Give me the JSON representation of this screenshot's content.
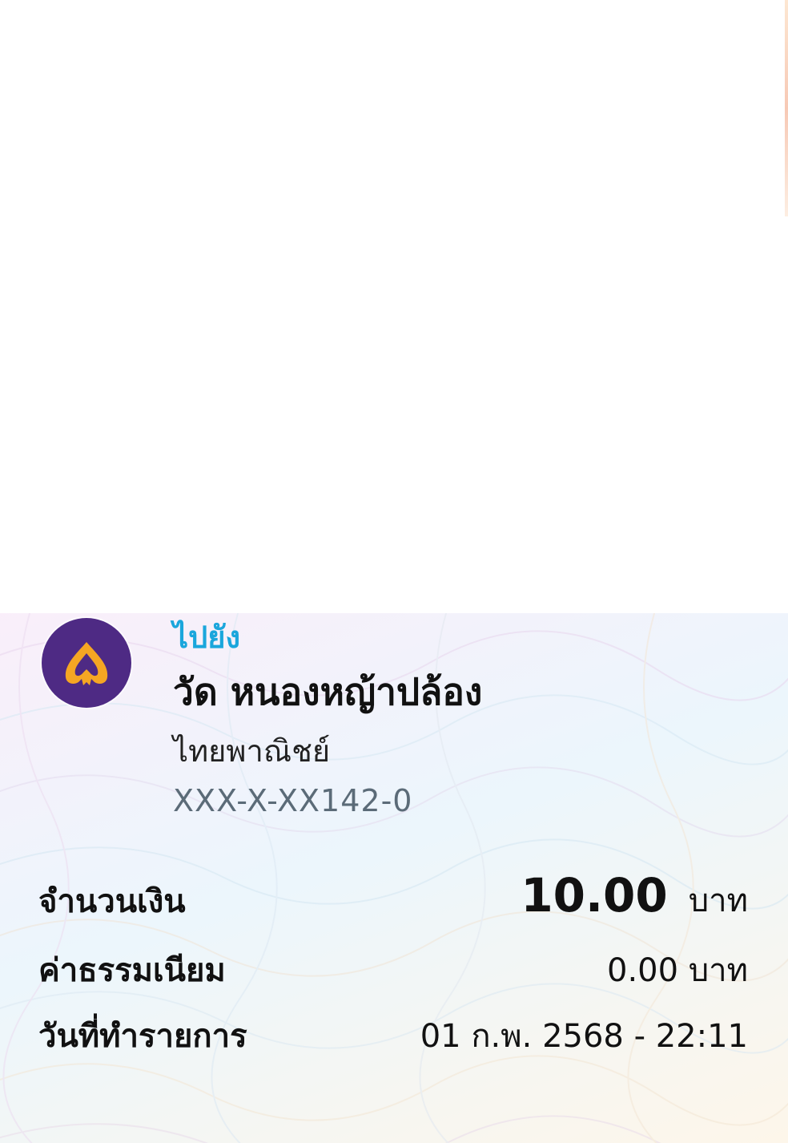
{
  "recipient": {
    "direction_label": "ไปยัง",
    "name": "วัด หนองหญ้าปล้อง",
    "bank": "ไทยพาณิชย์",
    "account": "XXX-X-XX142-0",
    "bank_logo_icon": "scb-bank-logo-icon",
    "bank_color": "#4e2a84",
    "logo_accent": "#f5a623"
  },
  "details": {
    "amount_label": "จำนวนเงิน",
    "amount_value": "10.00",
    "amount_unit": "บาท",
    "fee_label": "ค่าธรรมเนียม",
    "fee_value": "0.00 บาท",
    "date_label": "วันที่ทำรายการ",
    "date_value": "01 ก.พ. 2568 - 22:11"
  },
  "colors": {
    "direction_label": "#1aa6dc",
    "account_text": "#5b6b78",
    "primary_text": "#111111"
  }
}
